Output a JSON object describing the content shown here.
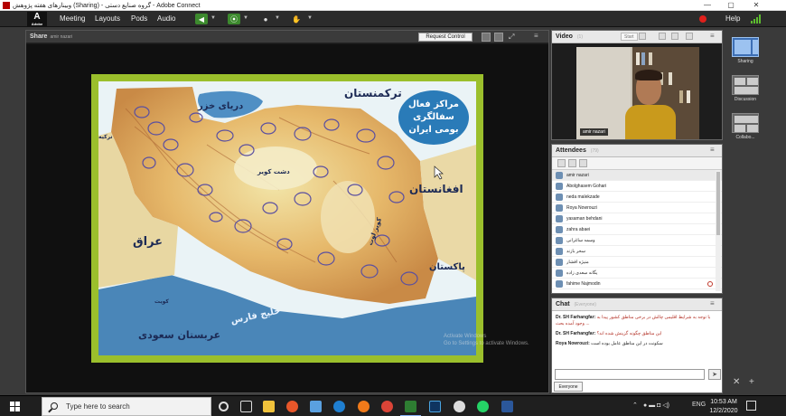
{
  "window": {
    "title": "وبینارهای هفته پژوهش (Sharing) - گروه صنایع دستی - Adobe Connect",
    "minimize": "—",
    "restore": "▢",
    "close": "✕"
  },
  "menubar": {
    "logo": "A",
    "logo_sub": "Adobe",
    "items": [
      "Meeting",
      "Layouts",
      "Pods",
      "Audio"
    ],
    "help": "Help"
  },
  "share_pod": {
    "title": "Share",
    "subtitle": "amir nazari",
    "request_control": "Request Control",
    "menu": "≡"
  },
  "map": {
    "labels": {
      "turkmenistan": "ترکمنستان",
      "caspian": "دریای خزر",
      "turkey": "ترکیه",
      "afghanistan": "افغانستان",
      "dasht_kavir": "دشت کویر",
      "lut": "کویر لوت",
      "iraq": "عراق",
      "kuwait": "کویت",
      "pakistan": "پاکستان",
      "saudi": "عربستان سعودی",
      "gulf": "خلیج فارس"
    },
    "bubble": [
      "مراکز فعال",
      "سفالگری",
      "بومی ایران"
    ]
  },
  "watermark": [
    "Go to Settings to activate Windows.",
    "Activate Windows"
  ],
  "video_pod": {
    "title": "Video",
    "count": "(1)",
    "start": "Start",
    "camera_name": "amir nazari"
  },
  "attendees_pod": {
    "title": "Attendees",
    "count": "(79)",
    "host": "amir nazari",
    "people": [
      "Abolghasem Gohari",
      "neda malekzade",
      "Roya Nowrouzi",
      "yasaman behdani",
      "zahra abaei",
      "وسمه ساغرانی",
      "سحر بازند",
      "منیژه افشار",
      "یگانه سعدی زاده",
      "fahime Najmodin"
    ]
  },
  "chat_pod": {
    "title": "Chat",
    "scope": "(Everyone)",
    "messages": [
      {
        "sender": "Dr. SH Farhangfar:",
        "text": "با توجه به شرایط اقلیمی چالش در برخی مناطق کشور پیدا به وجود آمده بحث ...",
        "color": "#b12b20"
      },
      {
        "sender": "Dr. SH Farhangfar:",
        "text": "این مناطق چگونه گزینش شده اند؟",
        "color": "#b12b20"
      },
      {
        "sender": "Roya Nowrouzi:",
        "text": "سکونت در این مناطق عامل بوده است",
        "color": "#222222"
      }
    ],
    "send": "➤",
    "everyone": "Everyone"
  },
  "layouts": [
    {
      "label": "Sharing",
      "active": true
    },
    {
      "label": "Discussion",
      "active": false
    },
    {
      "label": "Collabo...",
      "active": false
    }
  ],
  "layout_controls": {
    "close": "✕",
    "add": "+"
  },
  "taskbar": {
    "search_placeholder": "Type here to search",
    "time": "10:53 AM",
    "date": "12/2/2020",
    "tray_lang": "ENG",
    "tray_caret": "⌃"
  }
}
